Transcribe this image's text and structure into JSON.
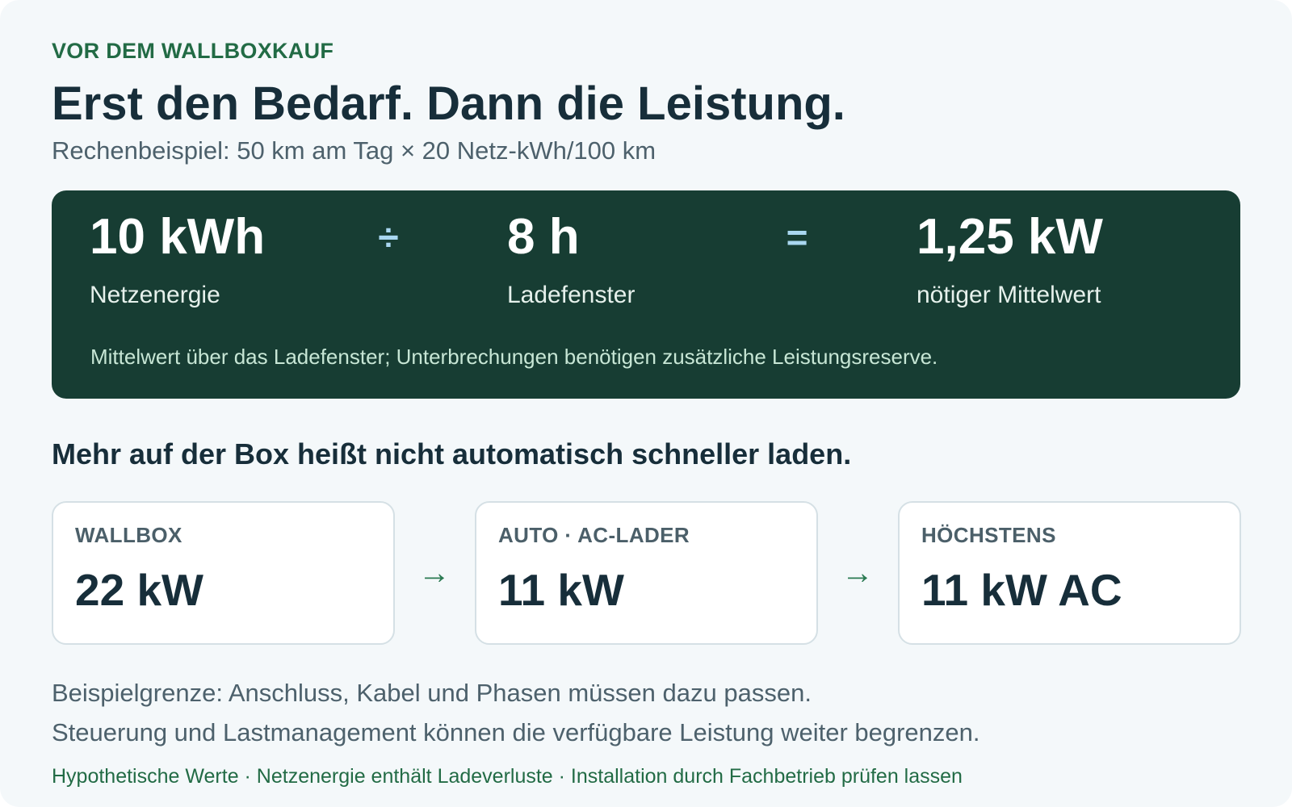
{
  "eyebrow": "VOR DEM WALLBOXKAUF",
  "title": "Erst den Bedarf. Dann die Leistung.",
  "subtitle": "Rechenbeispiel: 50 km am Tag × 20 Netz-kWh/100 km",
  "formula": {
    "energy": {
      "value": "10 kWh",
      "label": "Netzenergie"
    },
    "divide_op": "÷",
    "window": {
      "value": "8 h",
      "label": "Ladefenster"
    },
    "equals_op": "=",
    "result": {
      "value": "1,25 kW",
      "label": "nötiger Mittelwert"
    },
    "note": "Mittelwert über das Ladefenster; Unterbrechungen benötigen zusätzliche Leistungsreserve."
  },
  "section_title": "Mehr auf der Box heißt nicht automatisch schneller laden.",
  "chain": {
    "wallbox": {
      "caption": "WALLBOX",
      "value": "22 kW"
    },
    "arrow_1": "→",
    "car": {
      "caption": "AUTO · AC-LADER",
      "value": "11 kW"
    },
    "arrow_2": "→",
    "max": {
      "caption": "HÖCHSTENS",
      "value": "11 kW AC"
    }
  },
  "limits": {
    "line1": "Beispielgrenze: Anschluss, Kabel und Phasen müssen dazu passen.",
    "line2": "Steuerung und Lastmanagement können die verfügbare Leistung weiter begrenzen."
  },
  "footer": "Hypothetische Werte · Netzenergie enthält Ladeverluste · Installation durch Fachbetrieb prüfen lassen",
  "colors": {
    "accent_green": "#226b45",
    "formula_bg": "#173d33",
    "operator": "#a9d7f0",
    "heading": "#172e3a"
  }
}
